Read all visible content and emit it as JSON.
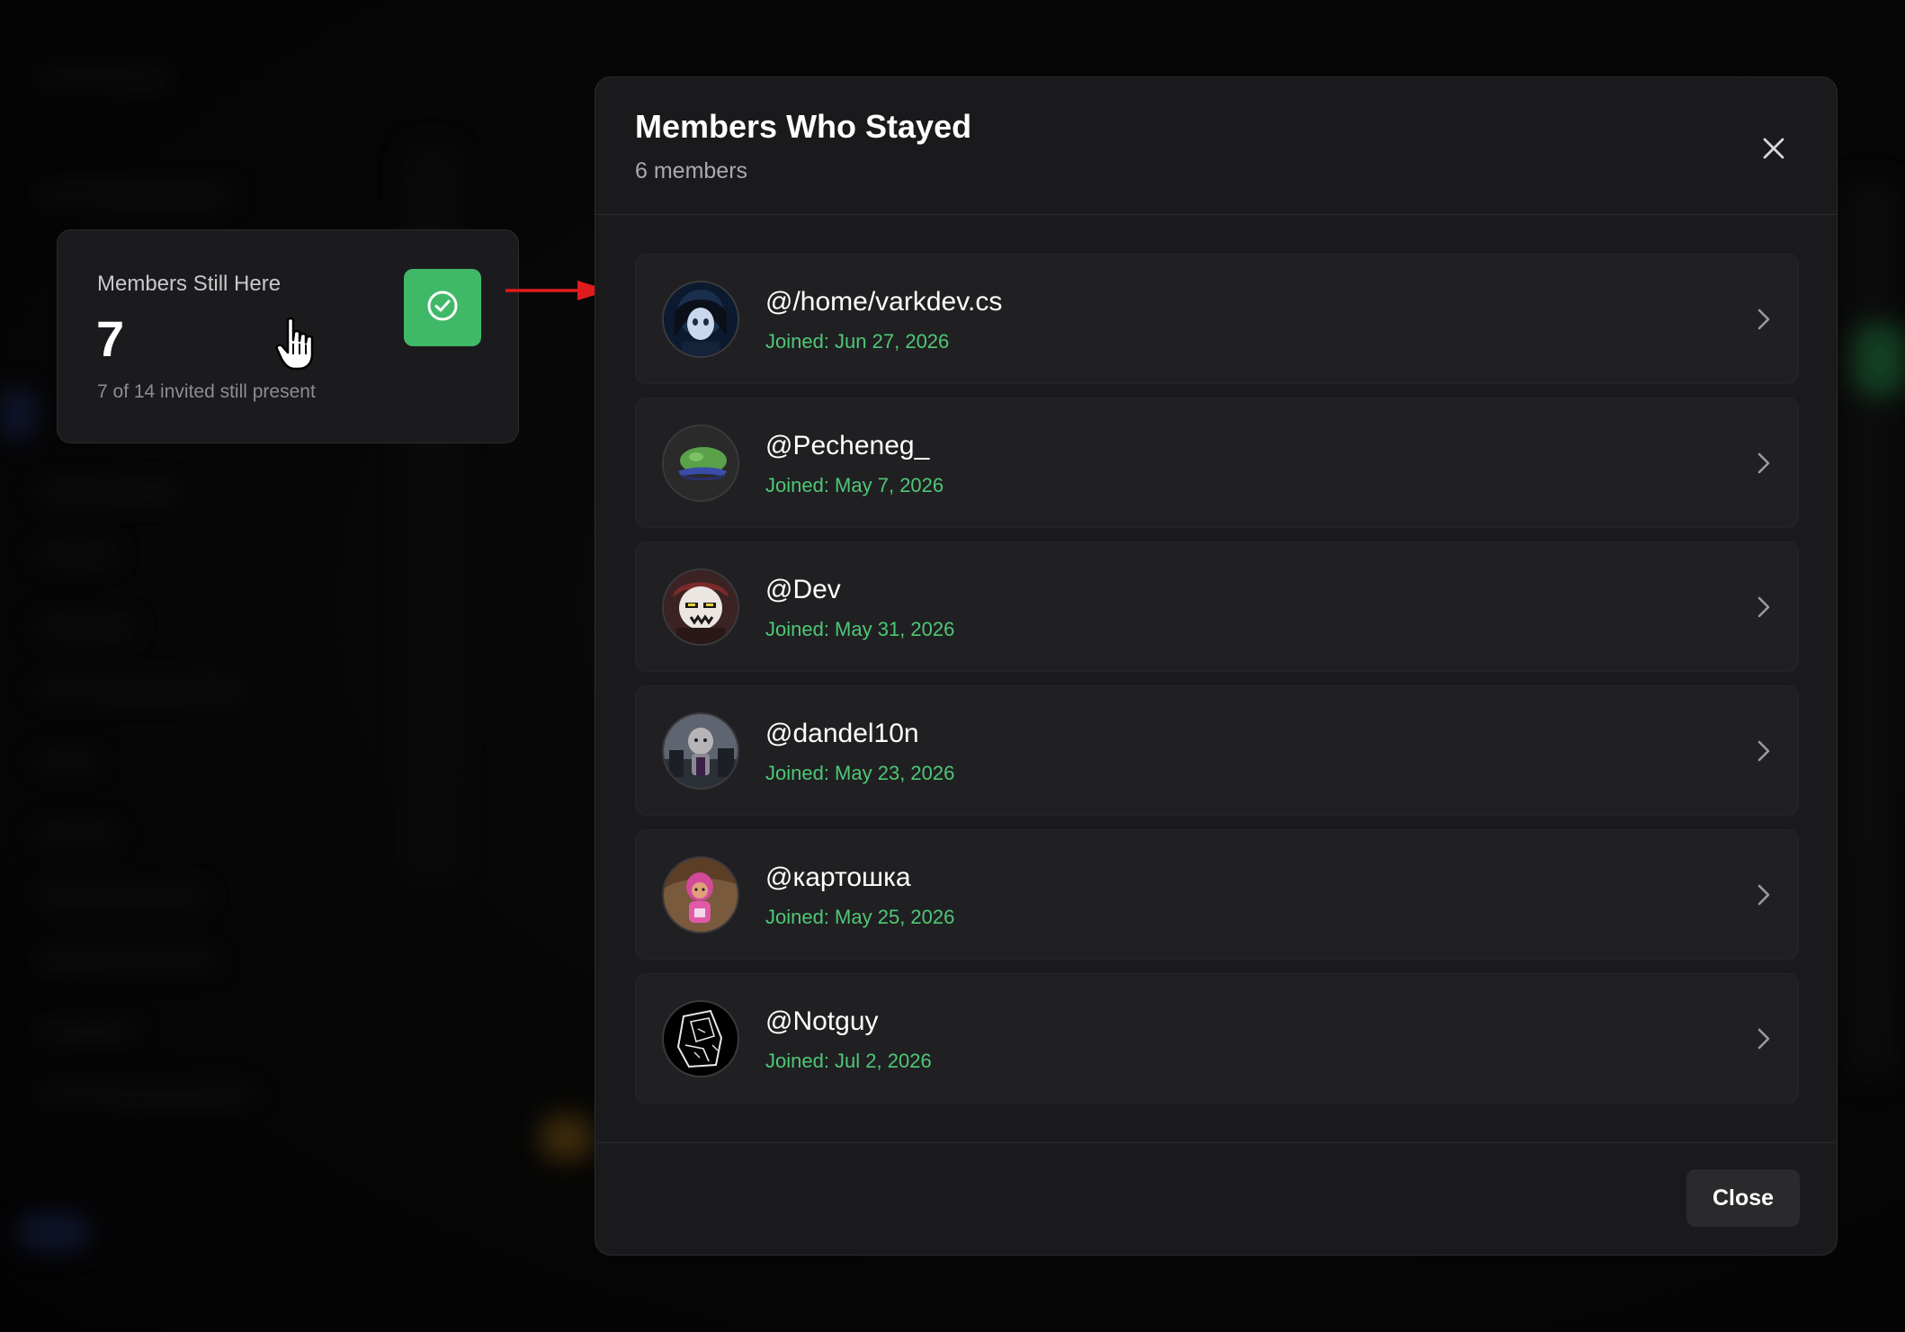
{
  "stat_card": {
    "title": "Members Still Here",
    "value": "7",
    "caption": "7 of 14 invited still present",
    "badge_icon": "check-circle-icon",
    "badge_color": "#3fb968"
  },
  "modal": {
    "title": "Members Who Stayed",
    "subtitle": "6 members",
    "close_icon": "close-icon",
    "members": [
      {
        "name": "@/home/varkdev.cs",
        "joined": "Joined: Jun 27, 2026"
      },
      {
        "name": "@Pecheneg_",
        "joined": "Joined: May 7, 2026"
      },
      {
        "name": "@Dev",
        "joined": "Joined: May 31, 2026"
      },
      {
        "name": "@dandel10n",
        "joined": "Joined: May 23, 2026"
      },
      {
        "name": "@картошка",
        "joined": "Joined: May 25, 2026"
      },
      {
        "name": "@Notguy",
        "joined": "Joined: Jul 2, 2026"
      }
    ],
    "footer": {
      "close_label": "Close"
    }
  },
  "colors": {
    "accent_green": "#4fc777",
    "badge_green": "#3fb968",
    "annotation_arrow": "#e01b1b"
  }
}
